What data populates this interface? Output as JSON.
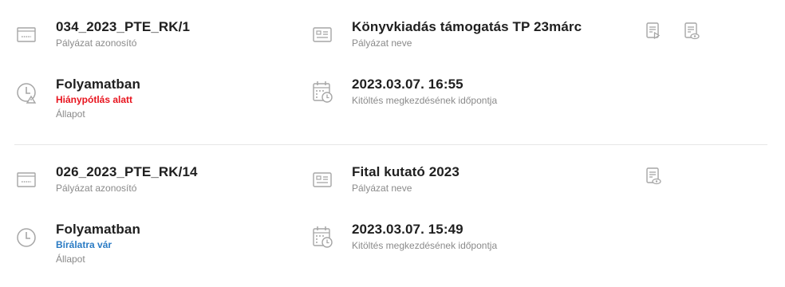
{
  "colors": {
    "value_text": "#1f1f1f",
    "label_text": "#8a8a8a",
    "icon_gray": "#a6a6a6",
    "status_missing": "#e8141e",
    "status_review": "#2a7bc4"
  },
  "records": [
    {
      "id_value": "034_2023_PTE_RK/1",
      "id_label": "Pályázat azonosító",
      "name_value": "Könyvkiadás támogatás TP 23márc",
      "name_label": "Pályázat neve",
      "state_value": "Folyamatban",
      "state_status": "Hiánypótlás alatt",
      "state_label": "Állapot",
      "date_value": "2023.03.07. 16:55",
      "date_label": "Kitöltés megkezdésének időpontja",
      "actions": [
        "document-send-icon",
        "document-view-icon"
      ]
    },
    {
      "id_value": "026_2023_PTE_RK/14",
      "id_label": "Pályázat azonosító",
      "name_value": "Fital kutató 2023",
      "name_label": "Pályázat neve",
      "state_value": "Folyamatban",
      "state_status": "Bírálatra vár",
      "state_label": "Állapot",
      "date_value": "2023.03.07. 15:49",
      "date_label": "Kitöltés megkezdésének időpontja",
      "actions": [
        "document-view-icon"
      ]
    }
  ]
}
